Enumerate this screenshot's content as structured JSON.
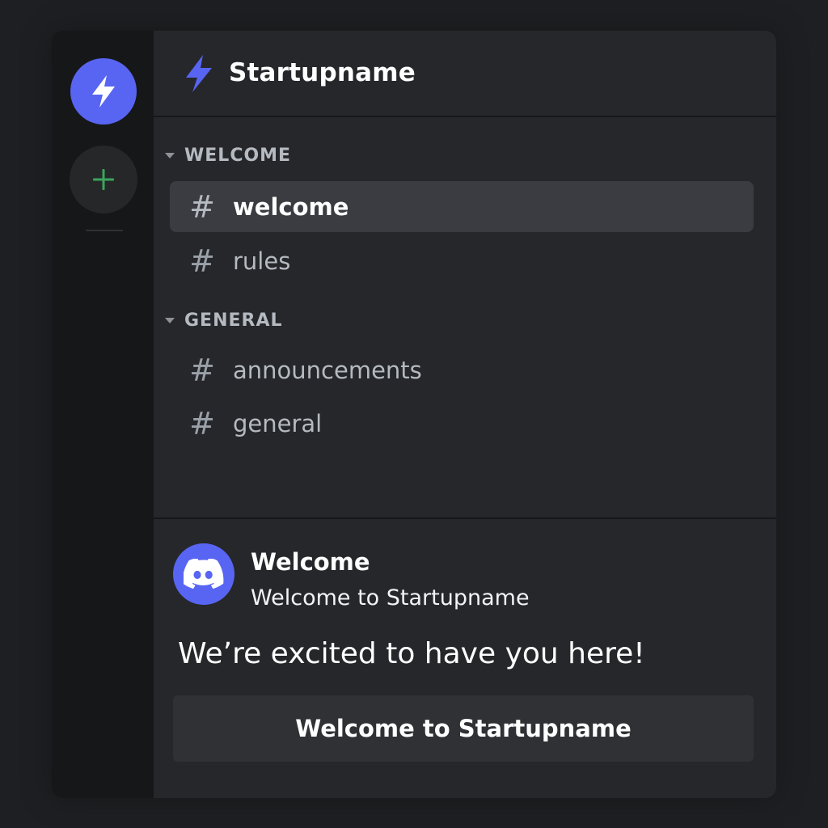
{
  "server": {
    "name": "Startupname",
    "icon": "lightning-bolt-icon",
    "accent_color": "#5865f2"
  },
  "rail": {
    "server_icon": "lightning-bolt-icon",
    "add_icon": "plus-icon",
    "add_icon_color": "#3ba55c"
  },
  "categories": [
    {
      "label": "WELCOME",
      "channels": [
        {
          "name": "welcome",
          "active": true
        },
        {
          "name": "rules",
          "active": false
        }
      ]
    },
    {
      "label": "GENERAL",
      "channels": [
        {
          "name": "announcements",
          "active": false
        },
        {
          "name": "general",
          "active": false
        }
      ]
    }
  ],
  "channel_prefix": "#",
  "welcome_message": {
    "avatar_icon": "discord-logo-icon",
    "title": "Welcome",
    "subtitle": "Welcome to Startupname",
    "body": "We’re excited to have you here!",
    "button_label": "Welcome to Startupname"
  }
}
